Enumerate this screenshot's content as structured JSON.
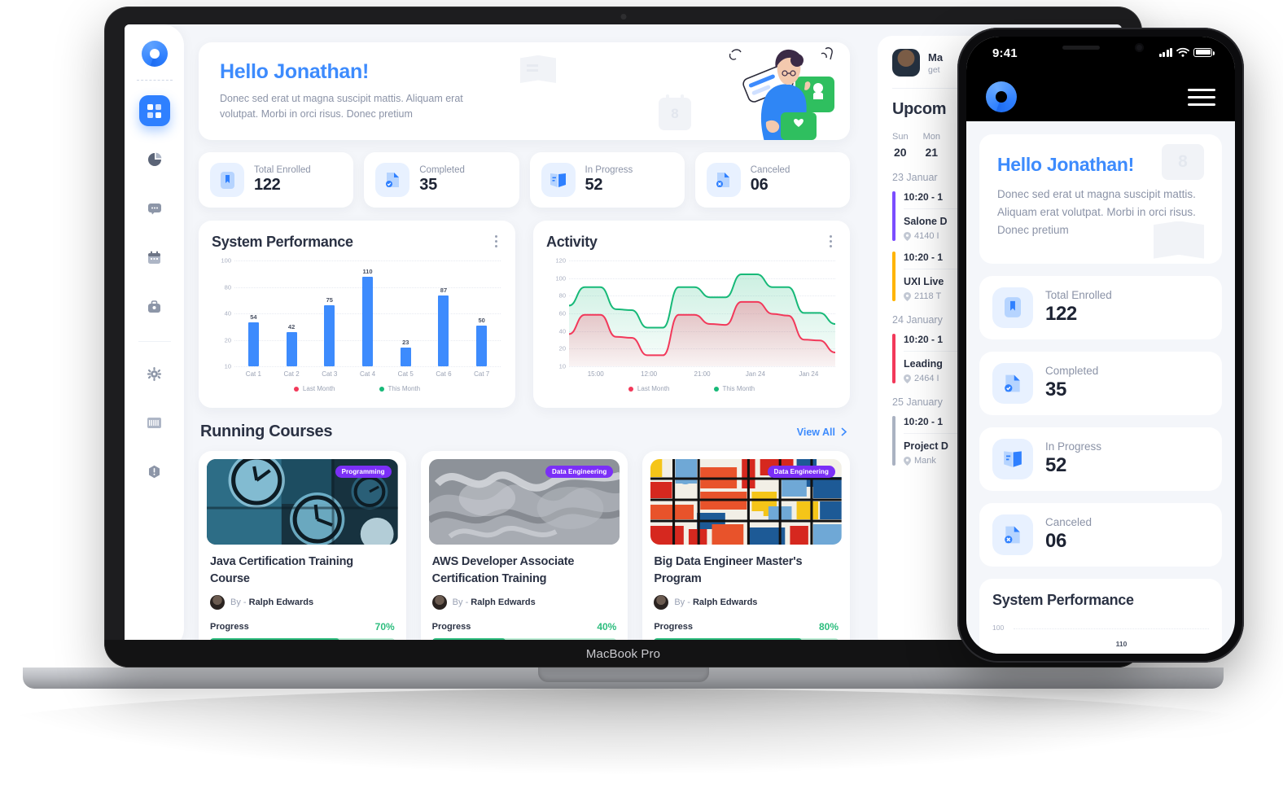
{
  "device": {
    "laptop_label": "MacBook Pro"
  },
  "sidebar": {
    "items": [
      {
        "name": "dashboard",
        "icon": "grid-icon",
        "active": true
      },
      {
        "name": "analytics",
        "icon": "pie-chart-icon",
        "active": false
      },
      {
        "name": "messages",
        "icon": "chat-icon",
        "active": false
      },
      {
        "name": "calendar",
        "icon": "calendar-icon",
        "active": false
      },
      {
        "name": "briefcase",
        "icon": "briefcase-icon",
        "active": false
      },
      {
        "name": "settings",
        "icon": "gear-icon",
        "active": false
      },
      {
        "name": "list",
        "icon": "list-icon",
        "active": false
      },
      {
        "name": "help",
        "icon": "alert-icon",
        "active": false
      }
    ]
  },
  "hero": {
    "greeting": "Hello",
    "name": "Jonathan!",
    "description": "Donec sed erat ut magna suscipit mattis. Aliquam erat volutpat. Morbi in orci risus. Donec pretium",
    "calendar_day": "8"
  },
  "stats": [
    {
      "label": "Total Enrolled",
      "value": "122",
      "icon": "bookmark-icon"
    },
    {
      "label": "Completed",
      "value": "35",
      "icon": "file-check-icon"
    },
    {
      "label": "In Progress",
      "value": "52",
      "icon": "open-book-icon"
    },
    {
      "label": "Canceled",
      "value": "06",
      "icon": "file-x-icon"
    }
  ],
  "chart_data": [
    {
      "type": "bar",
      "title": "System Performance",
      "categories": [
        "Cat 1",
        "Cat 2",
        "Cat 3",
        "Cat 4",
        "Cat 5",
        "Cat 6",
        "Cat 7"
      ],
      "values": [
        54,
        42,
        75,
        110,
        23,
        87,
        50
      ],
      "ytick_labels": [
        "100",
        "80",
        "40",
        "20",
        "10"
      ],
      "xlabel": "",
      "ylabel": "",
      "ylim": [
        0,
        120
      ],
      "grid": true,
      "bar_color": "#3d8bfd",
      "legend_position": "bottom",
      "legend": [
        {
          "name": "Last Month",
          "color": "#f2395a"
        },
        {
          "name": "This Month",
          "color": "#17b978"
        }
      ]
    },
    {
      "type": "area",
      "title": "Activity",
      "x": [
        "15:00",
        "12:00",
        "21:00",
        "Jan 24",
        "Jan 24"
      ],
      "ytick_labels": [
        "120",
        "100",
        "80",
        "60",
        "40",
        "20",
        "10"
      ],
      "ylim": [
        10,
        120
      ],
      "grid": true,
      "legend_position": "bottom",
      "series": [
        {
          "name": "This Month",
          "color": "#17b978",
          "values": [
            76,
            96,
            96,
            72,
            71,
            52,
            52,
            96,
            96,
            85,
            85,
            110,
            110,
            96,
            96,
            68,
            68,
            56
          ]
        },
        {
          "name": "Last Month",
          "color": "#f2395a",
          "values": [
            45,
            66,
            66,
            42,
            41,
            22,
            22,
            66,
            66,
            56,
            55,
            80,
            80,
            67,
            65,
            39,
            38,
            25
          ]
        }
      ]
    }
  ],
  "running_courses": {
    "title": "Running Courses",
    "view_all": "View All",
    "courses": [
      {
        "tag": "Programming",
        "title": "Java Certification Training Course",
        "by_prefix": "By -",
        "author": "Ralph Edwards",
        "progress_label": "Progress",
        "progress": "70%",
        "progress_value": 70,
        "thumb": "clocks-blue-image"
      },
      {
        "tag": "Data Engineering",
        "title": "AWS Developer Associate Certification Training",
        "by_prefix": "By -",
        "author": "Ralph Edwards",
        "progress_label": "Progress",
        "progress": "40%",
        "progress_value": 40,
        "thumb": "grey-smoke-image"
      },
      {
        "tag": "Data Engineering",
        "title": "Big Data Engineer Master's Program",
        "by_prefix": "By -",
        "author": "Ralph Edwards",
        "progress_label": "Progress",
        "progress": "80%",
        "progress_value": 80,
        "thumb": "mondrian-blocks-image"
      }
    ]
  },
  "right_panel": {
    "profile": {
      "name": "Ma",
      "email": "get"
    },
    "title": "Upcom",
    "days": [
      {
        "name": "Sun",
        "date": "20"
      },
      {
        "name": "Mon",
        "date": "21"
      }
    ],
    "groups": [
      {
        "date": "23 Januar",
        "events": [
          {
            "time": "10:20 - 1",
            "title": "Salone D",
            "location": "4140 I",
            "color": "#7b4dff"
          },
          {
            "time": "10:20 - 1",
            "title": "UXI Live",
            "location": "2118 T",
            "color": "#ffb400"
          }
        ]
      },
      {
        "date": "24 January",
        "events": [
          {
            "time": "10:20 - 1",
            "title": "Leading",
            "location": "2464 I",
            "color": "#f2395a"
          }
        ]
      },
      {
        "date": "25 January",
        "events": [
          {
            "time": "10:20 - 1",
            "title": "Project D",
            "location": "Mank",
            "color": "#aab2c2"
          }
        ]
      }
    ]
  },
  "phone": {
    "status_time": "9:41",
    "hero": {
      "greeting": "Hello",
      "name": "Jonathan!",
      "description": "Donec sed erat ut magna suscipit mattis. Aliquam erat volutpat. Morbi in orci risus. Donec pretium",
      "calendar_day": "8"
    },
    "stats": [
      {
        "label": "Total Enrolled",
        "value": "122",
        "icon": "bookmark-icon"
      },
      {
        "label": "Completed",
        "value": "35",
        "icon": "file-check-icon"
      },
      {
        "label": "In Progress",
        "value": "52",
        "icon": "open-book-icon"
      },
      {
        "label": "Canceled",
        "value": "06",
        "icon": "file-x-icon"
      }
    ],
    "panel_title": "System Performance",
    "mini_y": "100",
    "mini_value": "110"
  },
  "colors": {
    "accent_blue": "#3d8bfd",
    "active_blue": "#2f80ff",
    "green": "#2dbd7e",
    "red": "#f2395a",
    "purple": "#7b2ff7"
  }
}
